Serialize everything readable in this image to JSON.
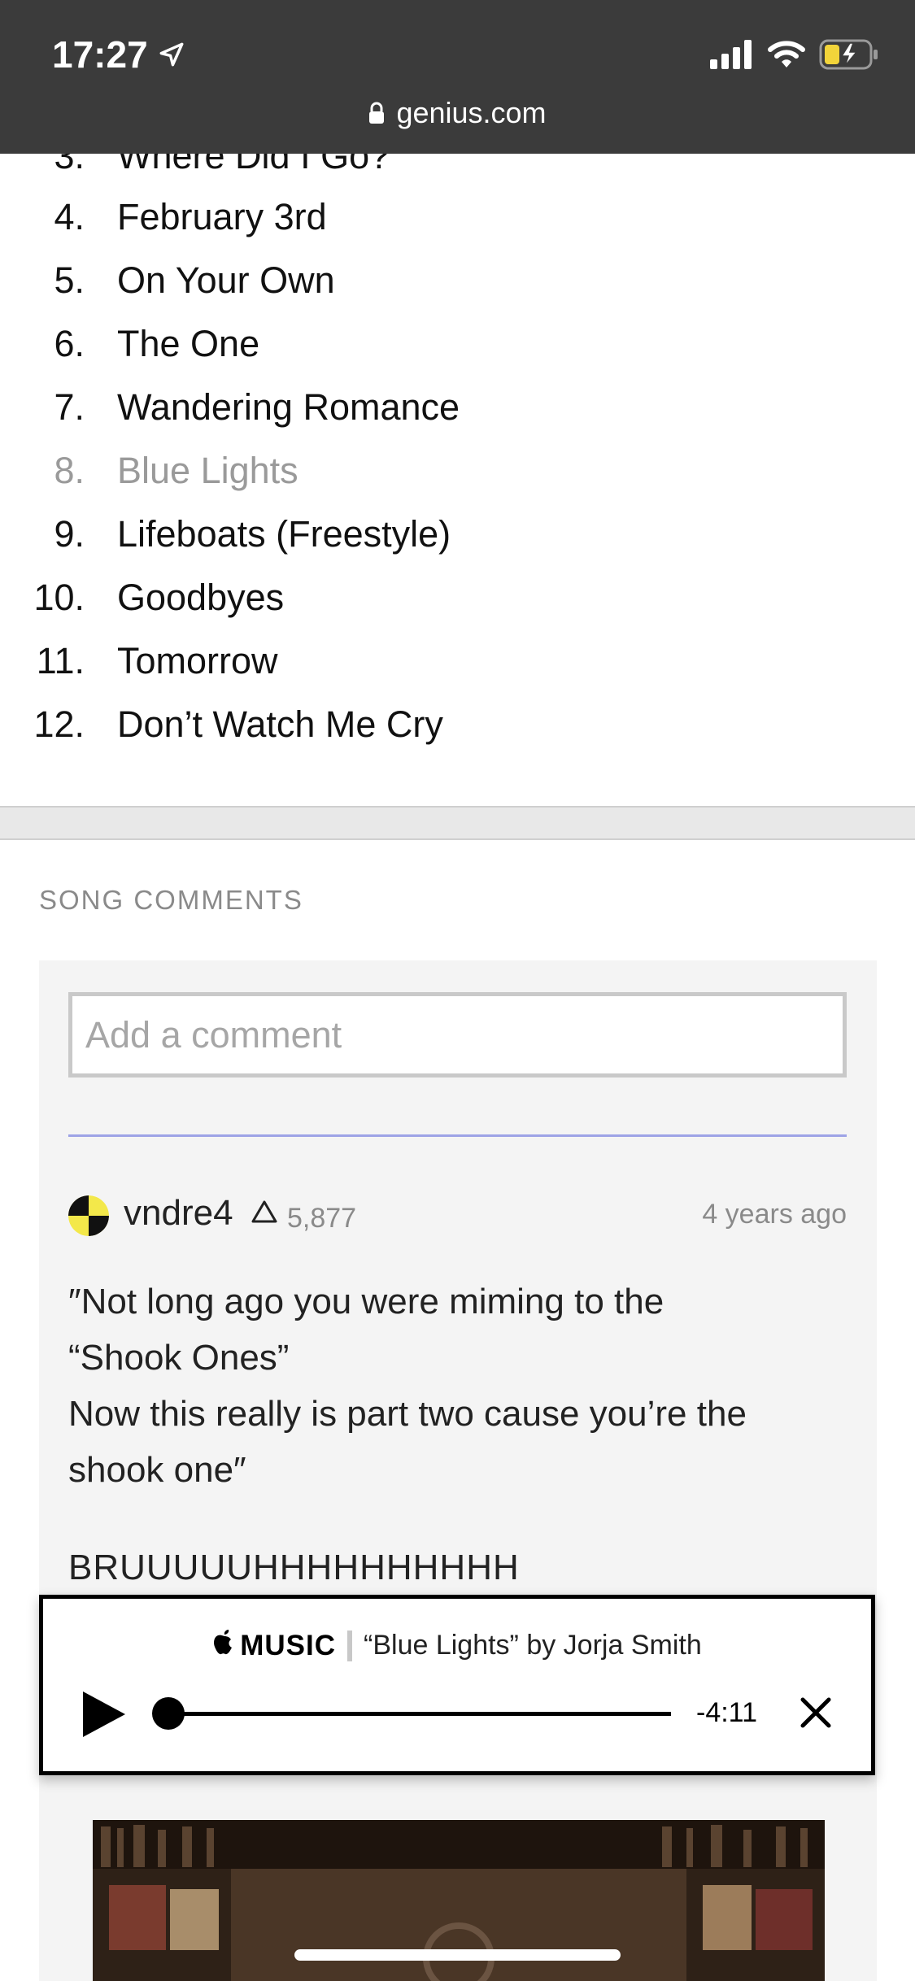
{
  "status_bar": {
    "time": "17:27",
    "url": "genius.com"
  },
  "tracklist": {
    "partial_title": "Where Did I Go?",
    "items": [
      {
        "num": "4.",
        "title": "February 3rd",
        "active": false
      },
      {
        "num": "5.",
        "title": "On Your Own",
        "active": false
      },
      {
        "num": "6.",
        "title": "The One",
        "active": false
      },
      {
        "num": "7.",
        "title": "Wandering Romance",
        "active": false
      },
      {
        "num": "8.",
        "title": "Blue Lights",
        "active": true
      },
      {
        "num": "9.",
        "title": "Lifeboats (Freestyle)",
        "active": false
      },
      {
        "num": "10.",
        "title": "Goodbyes",
        "active": false
      },
      {
        "num": "11.",
        "title": "Tomorrow",
        "active": false
      },
      {
        "num": "12.",
        "title": "Don’t Watch Me Cry",
        "active": false
      }
    ]
  },
  "comments": {
    "section_label": "SONG COMMENTS",
    "input_placeholder": "Add a comment",
    "first": {
      "username": "vndre4",
      "iq": "5,877",
      "time_ago": "4 years ago",
      "lines": [
        "″Not long ago you were miming to the",
        "“Shook Ones”",
        "Now this really is part two cause you’re the",
        "shook one″"
      ],
      "shout": "BRUUUUUHHHHHHHHHH"
    }
  },
  "player": {
    "service": "MUSIC",
    "song": "“Blue Lights” by Jorja Smith",
    "remaining": "-4:11",
    "progress": 0
  },
  "colors": {
    "topbar": "#3b3b3b",
    "accent_line": "#9da3e6",
    "avatar_yellow": "#f3e84a"
  }
}
